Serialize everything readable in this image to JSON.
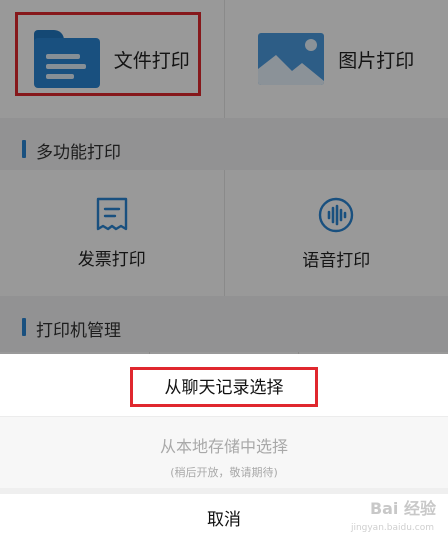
{
  "print_types": [
    {
      "label": "文件打印",
      "icon": "folder-icon"
    },
    {
      "label": "图片打印",
      "icon": "image-icon"
    }
  ],
  "sections": {
    "multifunction": "多功能打印",
    "printer_manage": "打印机管理"
  },
  "multi_items": [
    {
      "label": "发票打印",
      "icon": "receipt-icon"
    },
    {
      "label": "语音打印",
      "icon": "voice-icon"
    }
  ],
  "sheet": {
    "option_chat": "从聊天记录选择",
    "option_local": "从本地存储中选择",
    "option_local_note": "(稍后开放，敬请期待)",
    "cancel": "取消"
  },
  "watermark": {
    "brand": "Bai 经验",
    "url": "jingyan.baidu.com"
  },
  "colors": {
    "accent": "#2a86d4",
    "highlight": "#e0282e",
    "overlay": "rgba(0,0,0,0.4)"
  }
}
